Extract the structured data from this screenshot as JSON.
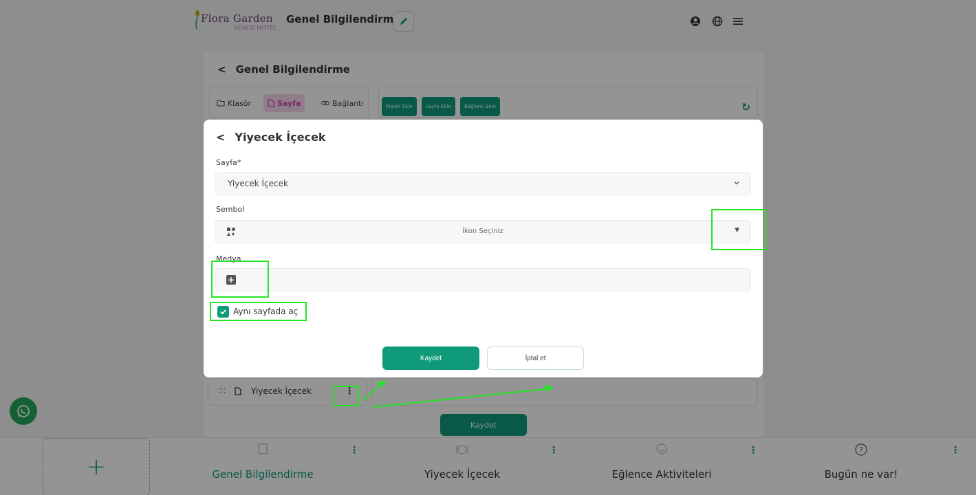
{
  "header": {
    "logo_main": "Flora Garden",
    "logo_sub": "BEACH HOTEL",
    "title": "Genel Bilgilendirme",
    "icons": [
      "user-icon",
      "globe-icon",
      "menu-icon"
    ]
  },
  "card": {
    "title": "Genel Bilgilendirme",
    "tabs": [
      {
        "label": "Klasör",
        "icon": "folder-icon"
      },
      {
        "label": "Sayfa",
        "icon": "page-icon",
        "active": true
      },
      {
        "label": "Bağlantı",
        "icon": "link-icon"
      }
    ],
    "actions": [
      "Klasör Ekle",
      "Sayfa Ekle",
      "Bağlantı Ekle"
    ],
    "list_item": "Yiyecek İçecek",
    "save_label": "Kaydet"
  },
  "modal": {
    "title": "Yiyecek İçecek",
    "page_label": "Sayfa*",
    "page_value": "Yiyecek İçecek",
    "symbol_label": "Sembol",
    "symbol_placeholder": "İkon Seçiniz",
    "media_label": "Medya",
    "same_page_label": "Aynı sayfada aç",
    "same_page_checked": true,
    "save_label": "Kaydet",
    "cancel_label": "İptal et"
  },
  "bottom_nav": {
    "items": [
      {
        "label": "Genel Bilgilendirme",
        "icon": "document-icon",
        "active": true
      },
      {
        "label": "Yiyecek İçecek",
        "icon": "food-icon"
      },
      {
        "label": "Eğlence Aktiviteleri",
        "icon": "mask-icon"
      },
      {
        "label": "Bugün ne var!",
        "icon": "question-icon"
      }
    ],
    "add_label": "+"
  },
  "colors": {
    "accent": "#0f9a7a",
    "highlight": "#22e622",
    "active_tab": "#d147b8"
  }
}
